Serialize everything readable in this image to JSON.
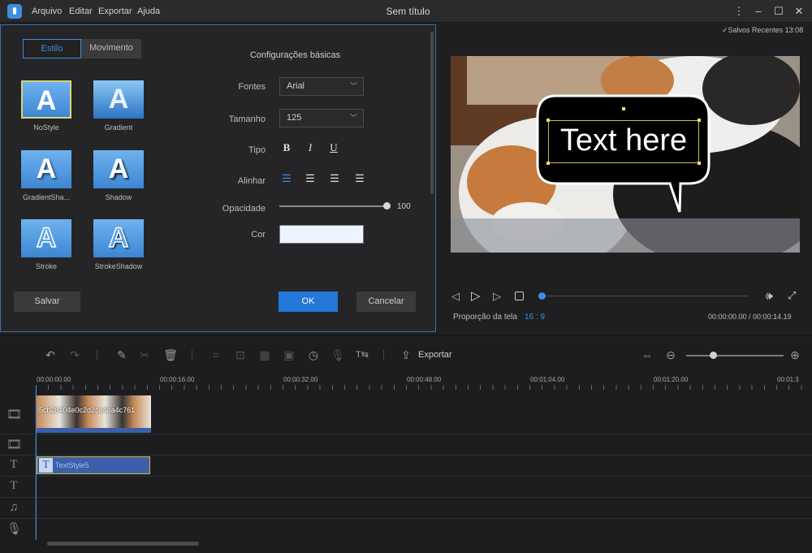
{
  "app": {
    "title": "Sem título",
    "saved": "Salvos Recentes 13:08"
  },
  "menu": [
    "Arquivo",
    "Editar",
    "Exportar",
    "Ajuda"
  ],
  "style_panel": {
    "tabs": [
      "Estilo",
      "Movimento"
    ],
    "styles": [
      {
        "label": "NoStyle"
      },
      {
        "label": "Gradient"
      },
      {
        "label": "GradientSha..."
      },
      {
        "label": "Shadow"
      },
      {
        "label": "Stroke"
      },
      {
        "label": "StrokeShadow"
      }
    ],
    "section_title": "Configurações básicas",
    "labels": {
      "font": "Fontes",
      "size": "Tamanho",
      "type": "Tipo",
      "align": "Alinhar",
      "opacity": "Opacidade",
      "color": "Cor"
    },
    "font_value": "Arial",
    "size_value": "125",
    "opacity_value": "100",
    "opacity_fraction": 1.0,
    "color_value": "#eef4ff",
    "buttons": {
      "save": "Salvar",
      "ok": "OK",
      "cancel": "Cancelar"
    }
  },
  "preview": {
    "bubble_text": "Text here",
    "aspect_label": "Proporção da tela",
    "aspect_value": "16 : 9",
    "time": "00:00:00.00 / 00:00:14.19",
    "progress_fraction": 0.0
  },
  "toolbar": {
    "export_label": "Exportar",
    "zoom_fraction": 0.24
  },
  "timeline": {
    "ticks": [
      "00:00:00.00",
      "00:00:16.00",
      "00:00:32.00",
      "00:00:48.00",
      "00:01:04.00",
      "00:01:20.00",
      "00:01:3"
    ],
    "video_clip_label": "5cb28404e0c2d2ce4ea4c761",
    "text_clip_label": "TextStyle5"
  },
  "colors": {
    "accent": "#3d8de0",
    "ok_button": "#2478d8",
    "text_clip": "#3d5ea8"
  }
}
